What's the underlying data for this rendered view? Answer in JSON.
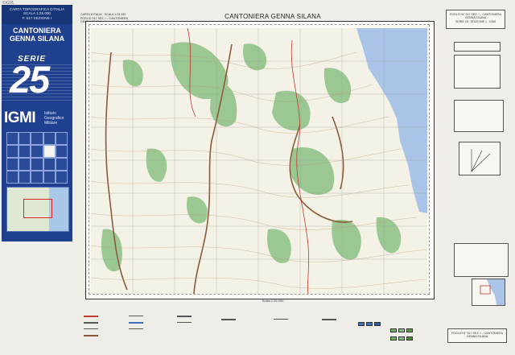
{
  "watermark": "©IGVL",
  "cover": {
    "series_label": "CARTA TOPOGRAFICA D'ITALIA",
    "scale": "SCALA 1:25 000",
    "sheet": "F. 517 SEZIONE I",
    "place_line1": "CANTONIERA",
    "place_line2": "GENNA SILANA",
    "serie": "SERIE",
    "serie_number": "25",
    "logo": "IGMI",
    "logo_sub1": "Istituto",
    "logo_sub2": "Geografico",
    "logo_sub3": "Militare"
  },
  "map": {
    "title": "CANTONIERA GENNA SILANA",
    "header_small1": "CARTA D'ITALIA · SCALA 1:25 000",
    "header_small2": "FOGLIO 517 SEZ. I – CANTONIERA GENNA SILANA",
    "bottom_caption": "Scala 1:25 000"
  },
  "right_panel": {
    "top_label1": "FOGLIO N° 517 SEZ. I – CANTONIERA",
    "top_label2": "GENNA SILANA",
    "top_label3": "SERIE 25 · EDIZIONE 1 · IGMI",
    "bottom_label1": "FOGLIO N° 517 SEZ. I – CANTONIERA",
    "bottom_label2": "GENNA SILANA"
  },
  "colors": {
    "sea": "#a9c4e6",
    "vegetation": "#7fb979",
    "paper": "#fbfaf6",
    "cover_blue": "#1f3f8f"
  }
}
